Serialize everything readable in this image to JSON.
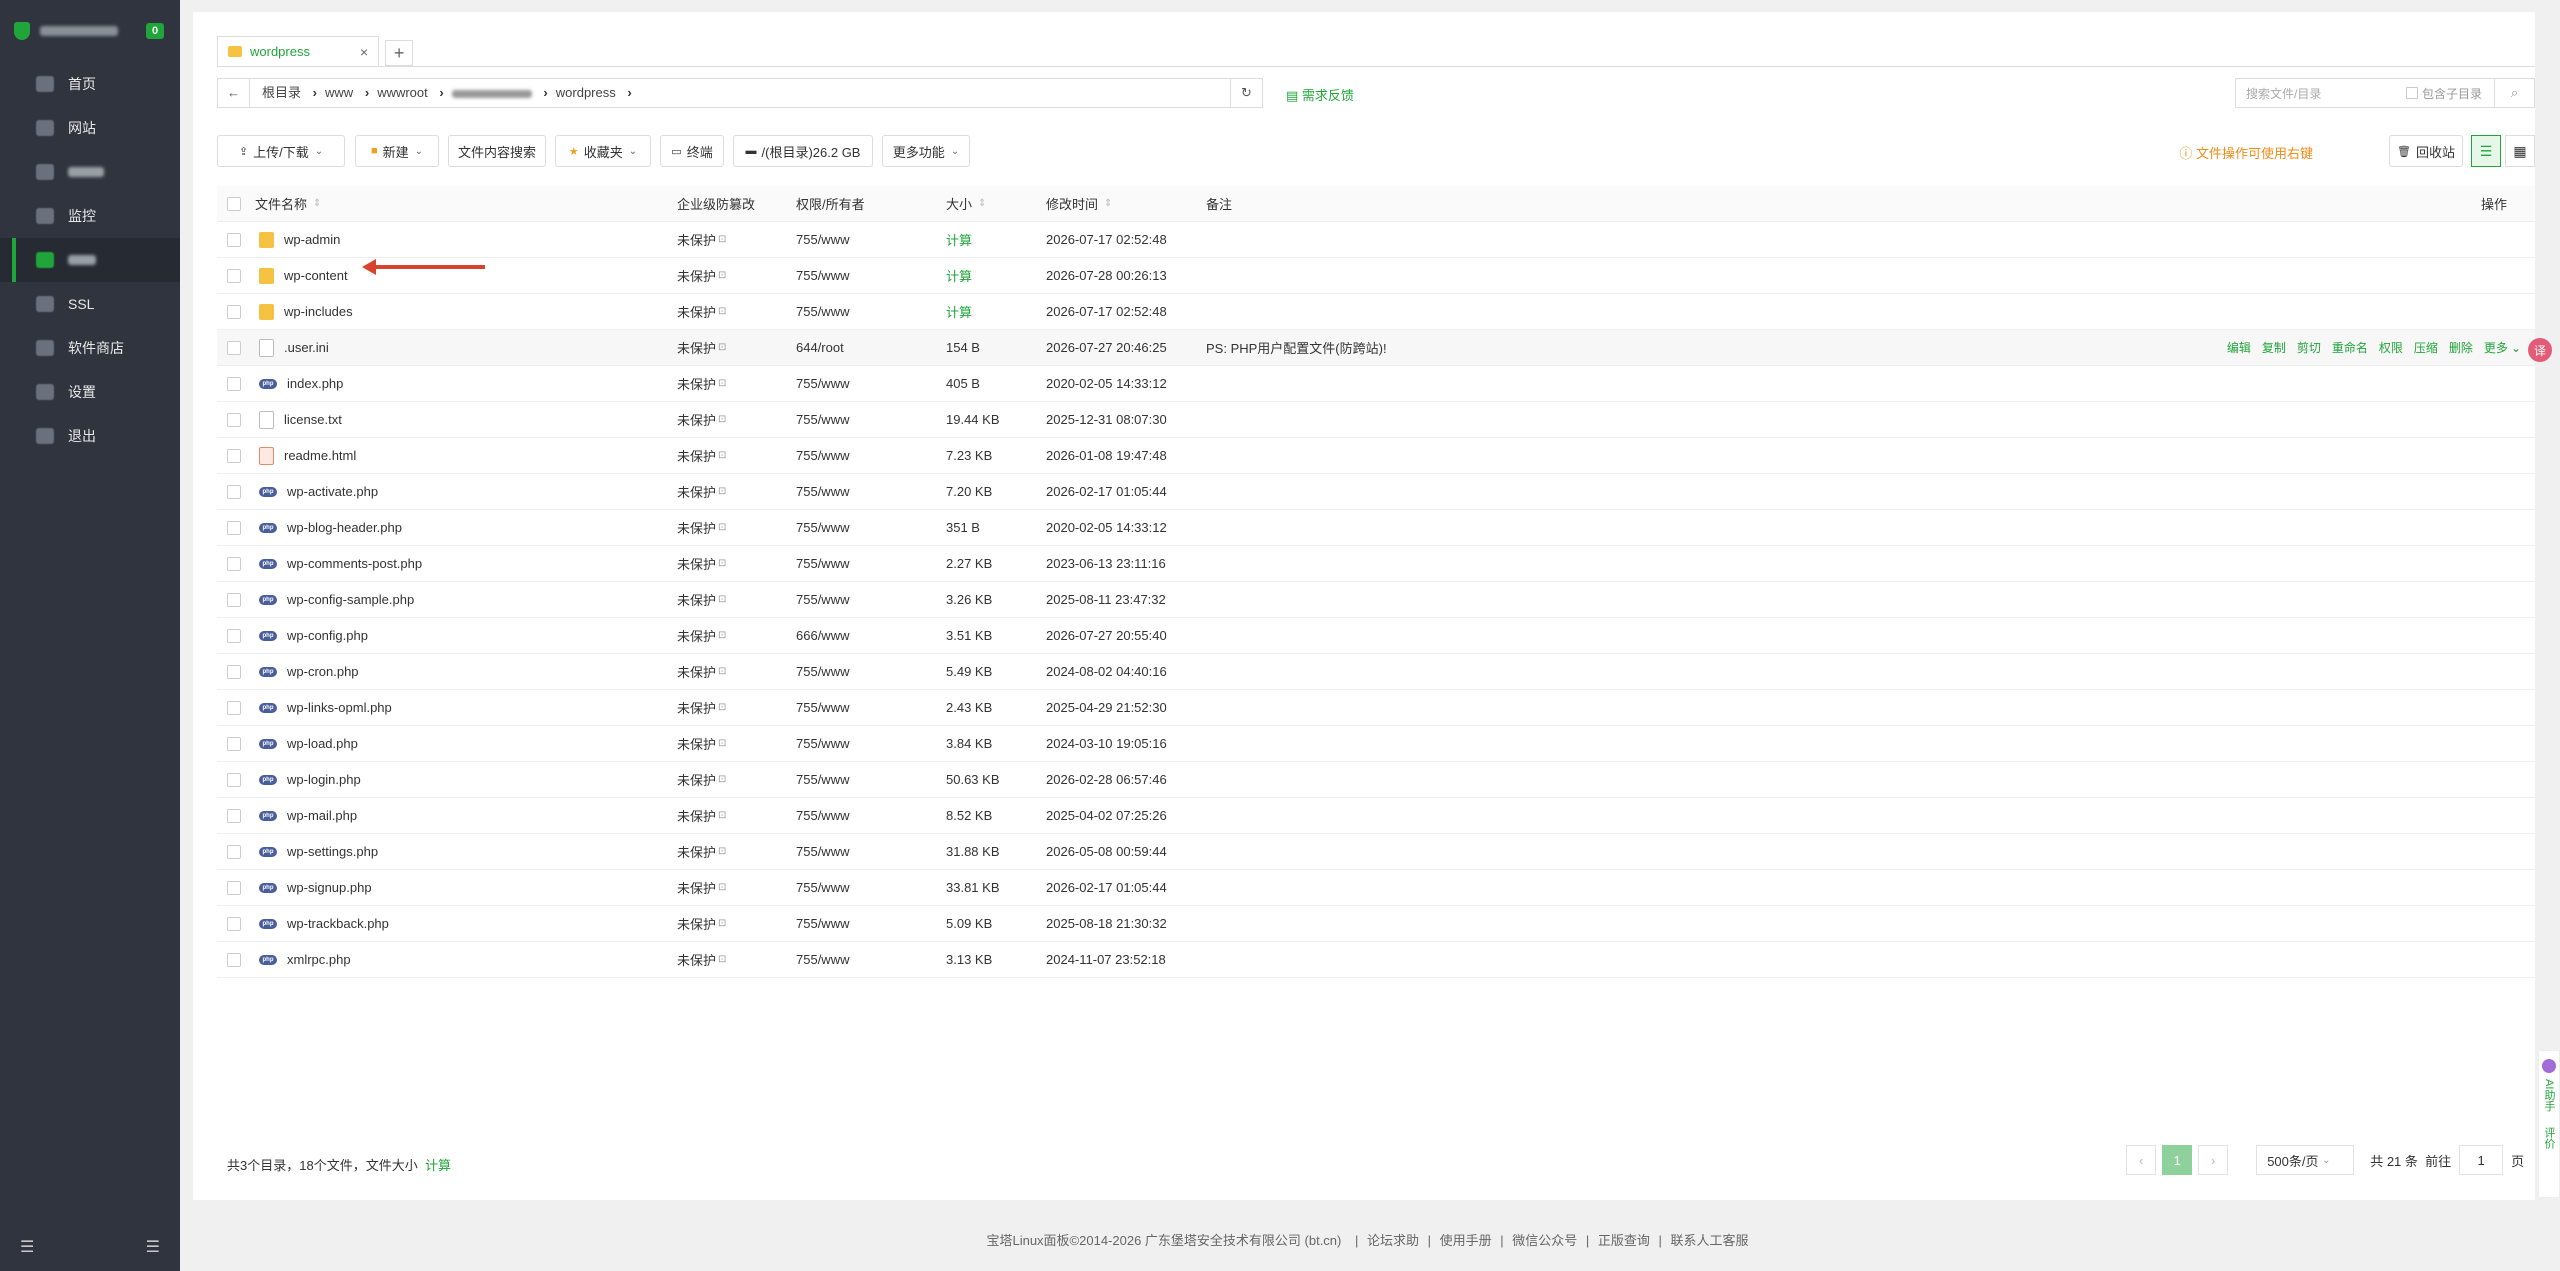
{
  "sidebar": {
    "badge": "0",
    "items": [
      {
        "label": "首页",
        "blurred": false
      },
      {
        "label": "网站",
        "blurred": false
      },
      {
        "label": "",
        "blurred": true
      },
      {
        "label": "监控",
        "blurred": false
      },
      {
        "label": "",
        "blurred": true,
        "active": true
      },
      {
        "label": "SSL",
        "blurred": false
      },
      {
        "label": "软件商店",
        "blurred": false
      },
      {
        "label": "设置",
        "blurred": false
      },
      {
        "label": "退出",
        "blurred": false
      }
    ]
  },
  "tab": {
    "label": "wordpress",
    "close": "×",
    "add": "+"
  },
  "path": {
    "back": "←",
    "crumbs": [
      "根目录",
      "www",
      "wwwroot",
      "",
      "wordpress"
    ],
    "refresh": "↻"
  },
  "feedback": "需求反馈",
  "search": {
    "placeholder": "搜索文件/目录",
    "include_sub": "包含子目录"
  },
  "toolbar": {
    "upload": "上传/下载",
    "new": "新建",
    "content_search": "文件内容搜索",
    "favorites": "收藏夹",
    "terminal": "终端",
    "disk": "/(根目录)26.2 GB",
    "more": "更多功能",
    "tip": "文件操作可使用右键",
    "recycle": "回收站"
  },
  "table": {
    "headers": {
      "name": "文件名称",
      "protect": "企业级防篡改",
      "perm": "权限/所有者",
      "size": "大小",
      "mtime": "修改时间",
      "remark": "备注",
      "ops": "操作"
    },
    "rows": [
      {
        "type": "folder",
        "name": "wp-admin",
        "protect": "未保护",
        "perm": "755/www",
        "size": "计算",
        "mtime": "2026-07-17 02:52:48",
        "remark": ""
      },
      {
        "type": "folder",
        "name": "wp-content",
        "protect": "未保护",
        "perm": "755/www",
        "size": "计算",
        "mtime": "2026-07-28 00:26:13",
        "remark": ""
      },
      {
        "type": "folder",
        "name": "wp-includes",
        "protect": "未保护",
        "perm": "755/www",
        "size": "计算",
        "mtime": "2026-07-17 02:52:48",
        "remark": ""
      },
      {
        "type": "file",
        "name": ".user.ini",
        "protect": "未保护",
        "perm": "644/root",
        "size": "154 B",
        "mtime": "2026-07-27 20:46:25",
        "remark": "PS: PHP用户配置文件(防跨站)!"
      },
      {
        "type": "php",
        "name": "index.php",
        "protect": "未保护",
        "perm": "755/www",
        "size": "405 B",
        "mtime": "2020-02-05 14:33:12",
        "remark": ""
      },
      {
        "type": "file",
        "name": "license.txt",
        "protect": "未保护",
        "perm": "755/www",
        "size": "19.44 KB",
        "mtime": "2025-12-31 08:07:30",
        "remark": ""
      },
      {
        "type": "html",
        "name": "readme.html",
        "protect": "未保护",
        "perm": "755/www",
        "size": "7.23 KB",
        "mtime": "2026-01-08 19:47:48",
        "remark": ""
      },
      {
        "type": "php",
        "name": "wp-activate.php",
        "protect": "未保护",
        "perm": "755/www",
        "size": "7.20 KB",
        "mtime": "2026-02-17 01:05:44",
        "remark": ""
      },
      {
        "type": "php",
        "name": "wp-blog-header.php",
        "protect": "未保护",
        "perm": "755/www",
        "size": "351 B",
        "mtime": "2020-02-05 14:33:12",
        "remark": ""
      },
      {
        "type": "php",
        "name": "wp-comments-post.php",
        "protect": "未保护",
        "perm": "755/www",
        "size": "2.27 KB",
        "mtime": "2023-06-13 23:11:16",
        "remark": ""
      },
      {
        "type": "php",
        "name": "wp-config-sample.php",
        "protect": "未保护",
        "perm": "755/www",
        "size": "3.26 KB",
        "mtime": "2025-08-11 23:47:32",
        "remark": ""
      },
      {
        "type": "php",
        "name": "wp-config.php",
        "protect": "未保护",
        "perm": "666/www",
        "size": "3.51 KB",
        "mtime": "2026-07-27 20:55:40",
        "remark": ""
      },
      {
        "type": "php",
        "name": "wp-cron.php",
        "protect": "未保护",
        "perm": "755/www",
        "size": "5.49 KB",
        "mtime": "2024-08-02 04:40:16",
        "remark": ""
      },
      {
        "type": "php",
        "name": "wp-links-opml.php",
        "protect": "未保护",
        "perm": "755/www",
        "size": "2.43 KB",
        "mtime": "2025-04-29 21:52:30",
        "remark": ""
      },
      {
        "type": "php",
        "name": "wp-load.php",
        "protect": "未保护",
        "perm": "755/www",
        "size": "3.84 KB",
        "mtime": "2024-03-10 19:05:16",
        "remark": ""
      },
      {
        "type": "php",
        "name": "wp-login.php",
        "protect": "未保护",
        "perm": "755/www",
        "size": "50.63 KB",
        "mtime": "2026-02-28 06:57:46",
        "remark": ""
      },
      {
        "type": "php",
        "name": "wp-mail.php",
        "protect": "未保护",
        "perm": "755/www",
        "size": "8.52 KB",
        "mtime": "2025-04-02 07:25:26",
        "remark": ""
      },
      {
        "type": "php",
        "name": "wp-settings.php",
        "protect": "未保护",
        "perm": "755/www",
        "size": "31.88 KB",
        "mtime": "2026-05-08 00:59:44",
        "remark": ""
      },
      {
        "type": "php",
        "name": "wp-signup.php",
        "protect": "未保护",
        "perm": "755/www",
        "size": "33.81 KB",
        "mtime": "2026-02-17 01:05:44",
        "remark": ""
      },
      {
        "type": "php",
        "name": "wp-trackback.php",
        "protect": "未保护",
        "perm": "755/www",
        "size": "5.09 KB",
        "mtime": "2025-08-18 21:30:32",
        "remark": ""
      },
      {
        "type": "php",
        "name": "xmlrpc.php",
        "protect": "未保护",
        "perm": "755/www",
        "size": "3.13 KB",
        "mtime": "2024-11-07 23:52:18",
        "remark": ""
      }
    ],
    "row_ops": [
      "编辑",
      "复制",
      "剪切",
      "重命名",
      "权限",
      "压缩",
      "删除",
      "更多"
    ]
  },
  "summary": {
    "text": "共3个目录，18个文件，文件大小",
    "calc": "计算"
  },
  "pager": {
    "prev": "‹",
    "current": "1",
    "next": "›",
    "per_page": "500条/页",
    "total": "共 21 条",
    "goto_label": "前往",
    "goto_value": "1",
    "page_unit": "页"
  },
  "footer": {
    "copyright": "宝塔Linux面板©2014-2026 广东堡塔安全技术有限公司 (bt.cn)",
    "links": [
      "论坛求助",
      "使用手册",
      "微信公众号",
      "正版查询",
      "联系人工客服"
    ]
  },
  "side": {
    "ai": "AI助手",
    "rate": "评价",
    "translate": "译"
  }
}
